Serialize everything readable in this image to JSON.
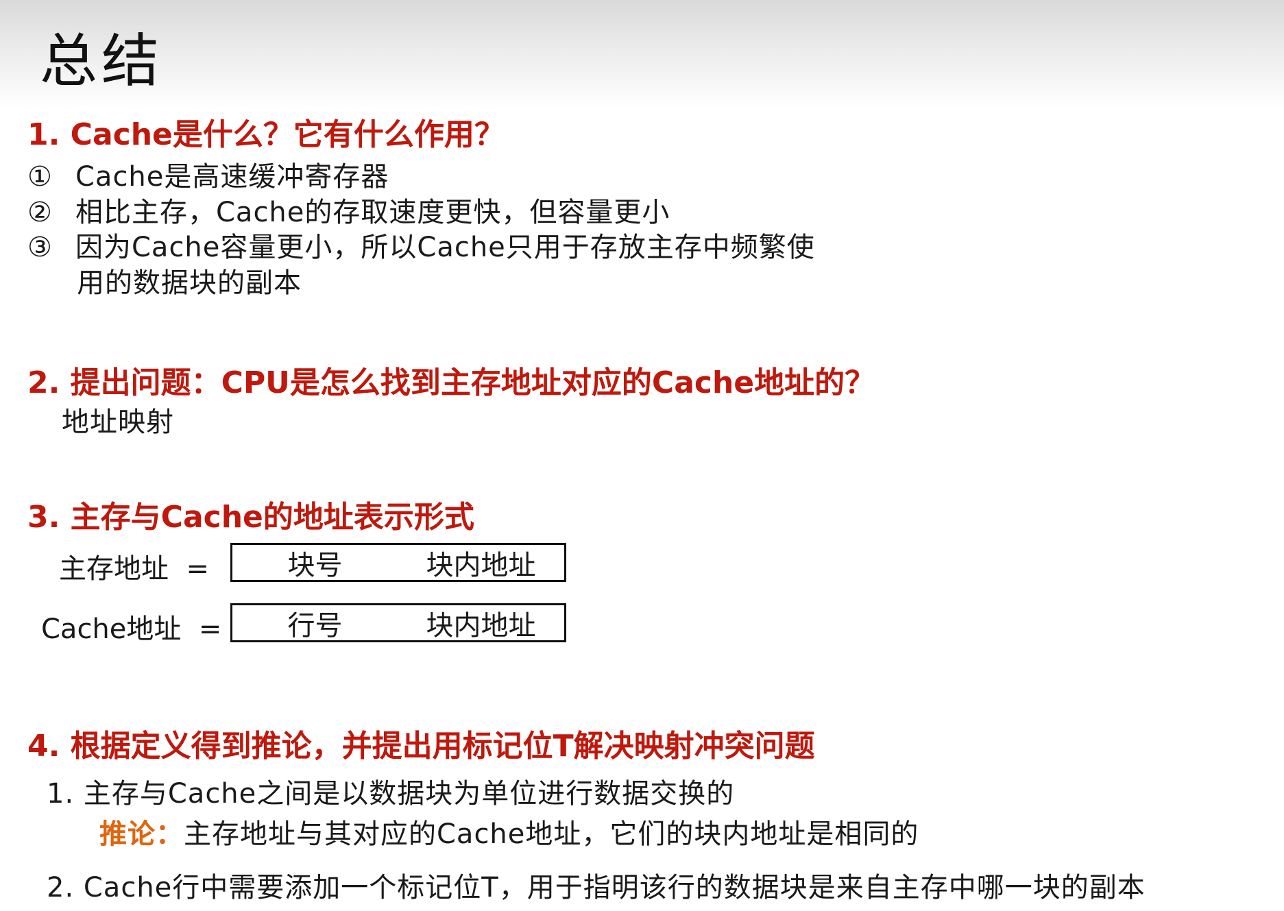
{
  "title": "总结",
  "sections": [
    {
      "heading": "1. Cache是什么？它有什么作用？",
      "items": [
        {
          "marker": "①",
          "text": "Cache是高速缓冲寄存器"
        },
        {
          "marker": "②",
          "text": "相比主存，Cache的存取速度更快，但容量更小"
        },
        {
          "marker": "③",
          "text": "因为Cache容量更小，所以Cache只用于存放主存中频繁使",
          "cont": "用的数据块的副本"
        }
      ]
    },
    {
      "heading": "2. 提出问题：CPU是怎么找到主存地址对应的Cache地址的？",
      "answer": "地址映射"
    },
    {
      "heading": "3. 主存与Cache的地址表示形式",
      "rows": [
        {
          "label": "主存地址",
          "eq": "=",
          "fields": [
            "块号",
            "块内地址"
          ]
        },
        {
          "label": "Cache地址",
          "eq": "=",
          "fields": [
            "行号",
            "块内地址"
          ]
        }
      ]
    },
    {
      "heading": "4. 根据定义得到推论，并提出用标记位T解决映射冲突问题",
      "points": [
        {
          "text": "1. 主存与Cache之间是以数据块为单位进行数据交换的",
          "inference_label": "推论：",
          "inference_text": "主存地址与其对应的Cache地址，它们的块内地址是相同的"
        },
        {
          "text": "2. Cache行中需要添加一个标记位T，用于指明该行的数据块是来自主存中哪一块的副本"
        }
      ]
    }
  ]
}
